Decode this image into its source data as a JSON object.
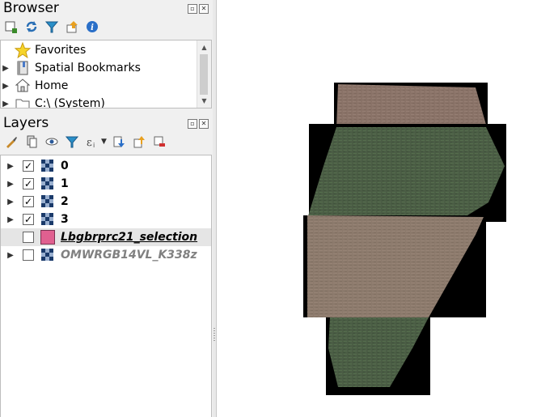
{
  "browser": {
    "title": "Browser",
    "items": [
      {
        "label": "Favorites",
        "icon": "star-icon",
        "expandable": false
      },
      {
        "label": "Spatial Bookmarks",
        "icon": "bookmark-book-icon",
        "expandable": true
      },
      {
        "label": "Home",
        "icon": "home-icon",
        "expandable": true
      },
      {
        "label": "C:\\ (System)",
        "icon": "folder-icon",
        "expandable": true
      }
    ]
  },
  "layers": {
    "title": "Layers",
    "items": [
      {
        "label": "0",
        "checked": true,
        "icon": "raster-icon",
        "expandable": true,
        "style": "bold"
      },
      {
        "label": "1",
        "checked": true,
        "icon": "raster-icon",
        "expandable": true,
        "style": "bold"
      },
      {
        "label": "2",
        "checked": true,
        "icon": "raster-icon",
        "expandable": true,
        "style": "bold"
      },
      {
        "label": "3",
        "checked": true,
        "icon": "raster-icon",
        "expandable": true,
        "style": "bold"
      },
      {
        "label": "Lbgbrprc21_selection",
        "checked": false,
        "icon": "polygon-fill-swatch",
        "expandable": false,
        "style": "bold-italic-underline",
        "selected": true
      },
      {
        "label": "OMWRGB14VL_K338z",
        "checked": false,
        "icon": "raster-icon",
        "expandable": true,
        "style": "bold-italic-gray"
      }
    ]
  },
  "colors": {
    "swatch_fill": "#e06090",
    "selected_row": "#e5e5e5"
  }
}
